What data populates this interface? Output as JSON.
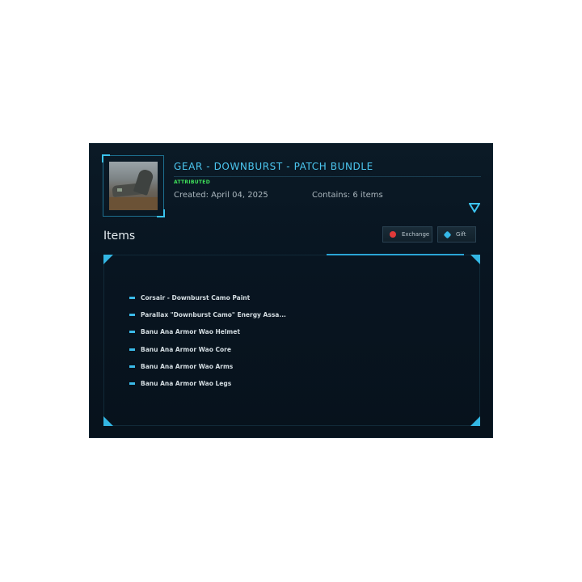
{
  "bundle": {
    "title": "GEAR - DOWNBURST - PATCH BUNDLE",
    "status": "ATTRIBUTED",
    "created": "Created: April 04, 2025",
    "contains": "Contains: 6 items"
  },
  "items_section": {
    "heading": "Items",
    "exchange_label": "Exchange",
    "gift_label": "Gift",
    "items": [
      "Corsair - Downburst Camo Paint",
      "Parallax \"Downburst Camo\" Energy Assa...",
      "Banu Ana Armor Wao Helmet",
      "Banu Ana Armor Wao Core",
      "Banu Ana Armor Wao Arms",
      "Banu Ana Armor Wao Legs"
    ]
  },
  "colors": {
    "accent": "#4cc7f0",
    "status": "#3fe15a",
    "exchange_icon": "#e03a3a"
  },
  "icons": {
    "expand": "chevron-down-icon",
    "exchange": "exchange-icon",
    "gift": "gift-icon",
    "item_bullet": "dash-icon"
  }
}
